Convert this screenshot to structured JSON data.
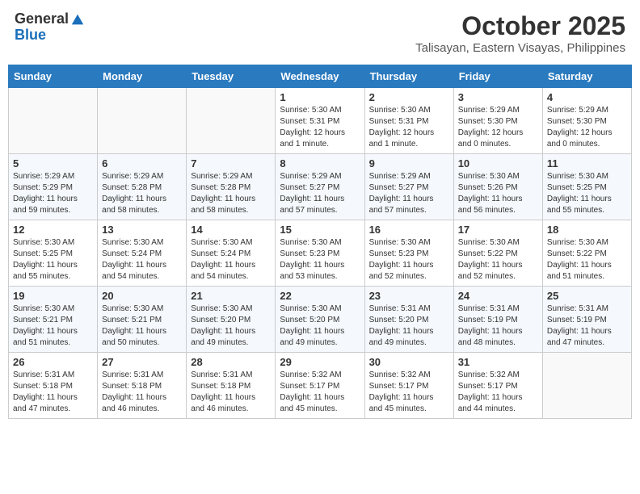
{
  "header": {
    "logo": {
      "general": "General",
      "blue": "Blue"
    },
    "month": "October 2025",
    "location": "Talisayan, Eastern Visayas, Philippines"
  },
  "weekdays": [
    "Sunday",
    "Monday",
    "Tuesday",
    "Wednesday",
    "Thursday",
    "Friday",
    "Saturday"
  ],
  "weeks": [
    {
      "days": [
        {
          "number": "",
          "sunrise": "",
          "sunset": "",
          "daylight": "",
          "empty": true
        },
        {
          "number": "",
          "sunrise": "",
          "sunset": "",
          "daylight": "",
          "empty": true
        },
        {
          "number": "",
          "sunrise": "",
          "sunset": "",
          "daylight": "",
          "empty": true
        },
        {
          "number": "1",
          "sunrise": "Sunrise: 5:30 AM",
          "sunset": "Sunset: 5:31 PM",
          "daylight": "Daylight: 12 hours and 1 minute."
        },
        {
          "number": "2",
          "sunrise": "Sunrise: 5:30 AM",
          "sunset": "Sunset: 5:31 PM",
          "daylight": "Daylight: 12 hours and 1 minute."
        },
        {
          "number": "3",
          "sunrise": "Sunrise: 5:29 AM",
          "sunset": "Sunset: 5:30 PM",
          "daylight": "Daylight: 12 hours and 0 minutes."
        },
        {
          "number": "4",
          "sunrise": "Sunrise: 5:29 AM",
          "sunset": "Sunset: 5:30 PM",
          "daylight": "Daylight: 12 hours and 0 minutes."
        }
      ]
    },
    {
      "days": [
        {
          "number": "5",
          "sunrise": "Sunrise: 5:29 AM",
          "sunset": "Sunset: 5:29 PM",
          "daylight": "Daylight: 11 hours and 59 minutes."
        },
        {
          "number": "6",
          "sunrise": "Sunrise: 5:29 AM",
          "sunset": "Sunset: 5:28 PM",
          "daylight": "Daylight: 11 hours and 58 minutes."
        },
        {
          "number": "7",
          "sunrise": "Sunrise: 5:29 AM",
          "sunset": "Sunset: 5:28 PM",
          "daylight": "Daylight: 11 hours and 58 minutes."
        },
        {
          "number": "8",
          "sunrise": "Sunrise: 5:29 AM",
          "sunset": "Sunset: 5:27 PM",
          "daylight": "Daylight: 11 hours and 57 minutes."
        },
        {
          "number": "9",
          "sunrise": "Sunrise: 5:29 AM",
          "sunset": "Sunset: 5:27 PM",
          "daylight": "Daylight: 11 hours and 57 minutes."
        },
        {
          "number": "10",
          "sunrise": "Sunrise: 5:30 AM",
          "sunset": "Sunset: 5:26 PM",
          "daylight": "Daylight: 11 hours and 56 minutes."
        },
        {
          "number": "11",
          "sunrise": "Sunrise: 5:30 AM",
          "sunset": "Sunset: 5:25 PM",
          "daylight": "Daylight: 11 hours and 55 minutes."
        }
      ]
    },
    {
      "days": [
        {
          "number": "12",
          "sunrise": "Sunrise: 5:30 AM",
          "sunset": "Sunset: 5:25 PM",
          "daylight": "Daylight: 11 hours and 55 minutes."
        },
        {
          "number": "13",
          "sunrise": "Sunrise: 5:30 AM",
          "sunset": "Sunset: 5:24 PM",
          "daylight": "Daylight: 11 hours and 54 minutes."
        },
        {
          "number": "14",
          "sunrise": "Sunrise: 5:30 AM",
          "sunset": "Sunset: 5:24 PM",
          "daylight": "Daylight: 11 hours and 54 minutes."
        },
        {
          "number": "15",
          "sunrise": "Sunrise: 5:30 AM",
          "sunset": "Sunset: 5:23 PM",
          "daylight": "Daylight: 11 hours and 53 minutes."
        },
        {
          "number": "16",
          "sunrise": "Sunrise: 5:30 AM",
          "sunset": "Sunset: 5:23 PM",
          "daylight": "Daylight: 11 hours and 52 minutes."
        },
        {
          "number": "17",
          "sunrise": "Sunrise: 5:30 AM",
          "sunset": "Sunset: 5:22 PM",
          "daylight": "Daylight: 11 hours and 52 minutes."
        },
        {
          "number": "18",
          "sunrise": "Sunrise: 5:30 AM",
          "sunset": "Sunset: 5:22 PM",
          "daylight": "Daylight: 11 hours and 51 minutes."
        }
      ]
    },
    {
      "days": [
        {
          "number": "19",
          "sunrise": "Sunrise: 5:30 AM",
          "sunset": "Sunset: 5:21 PM",
          "daylight": "Daylight: 11 hours and 51 minutes."
        },
        {
          "number": "20",
          "sunrise": "Sunrise: 5:30 AM",
          "sunset": "Sunset: 5:21 PM",
          "daylight": "Daylight: 11 hours and 50 minutes."
        },
        {
          "number": "21",
          "sunrise": "Sunrise: 5:30 AM",
          "sunset": "Sunset: 5:20 PM",
          "daylight": "Daylight: 11 hours and 49 minutes."
        },
        {
          "number": "22",
          "sunrise": "Sunrise: 5:30 AM",
          "sunset": "Sunset: 5:20 PM",
          "daylight": "Daylight: 11 hours and 49 minutes."
        },
        {
          "number": "23",
          "sunrise": "Sunrise: 5:31 AM",
          "sunset": "Sunset: 5:20 PM",
          "daylight": "Daylight: 11 hours and 49 minutes."
        },
        {
          "number": "24",
          "sunrise": "Sunrise: 5:31 AM",
          "sunset": "Sunset: 5:19 PM",
          "daylight": "Daylight: 11 hours and 48 minutes."
        },
        {
          "number": "25",
          "sunrise": "Sunrise: 5:31 AM",
          "sunset": "Sunset: 5:19 PM",
          "daylight": "Daylight: 11 hours and 47 minutes."
        }
      ]
    },
    {
      "days": [
        {
          "number": "26",
          "sunrise": "Sunrise: 5:31 AM",
          "sunset": "Sunset: 5:18 PM",
          "daylight": "Daylight: 11 hours and 47 minutes."
        },
        {
          "number": "27",
          "sunrise": "Sunrise: 5:31 AM",
          "sunset": "Sunset: 5:18 PM",
          "daylight": "Daylight: 11 hours and 46 minutes."
        },
        {
          "number": "28",
          "sunrise": "Sunrise: 5:31 AM",
          "sunset": "Sunset: 5:18 PM",
          "daylight": "Daylight: 11 hours and 46 minutes."
        },
        {
          "number": "29",
          "sunrise": "Sunrise: 5:32 AM",
          "sunset": "Sunset: 5:17 PM",
          "daylight": "Daylight: 11 hours and 45 minutes."
        },
        {
          "number": "30",
          "sunrise": "Sunrise: 5:32 AM",
          "sunset": "Sunset: 5:17 PM",
          "daylight": "Daylight: 11 hours and 45 minutes."
        },
        {
          "number": "31",
          "sunrise": "Sunrise: 5:32 AM",
          "sunset": "Sunset: 5:17 PM",
          "daylight": "Daylight: 11 hours and 44 minutes."
        },
        {
          "number": "",
          "sunrise": "",
          "sunset": "",
          "daylight": "",
          "empty": true
        }
      ]
    }
  ]
}
